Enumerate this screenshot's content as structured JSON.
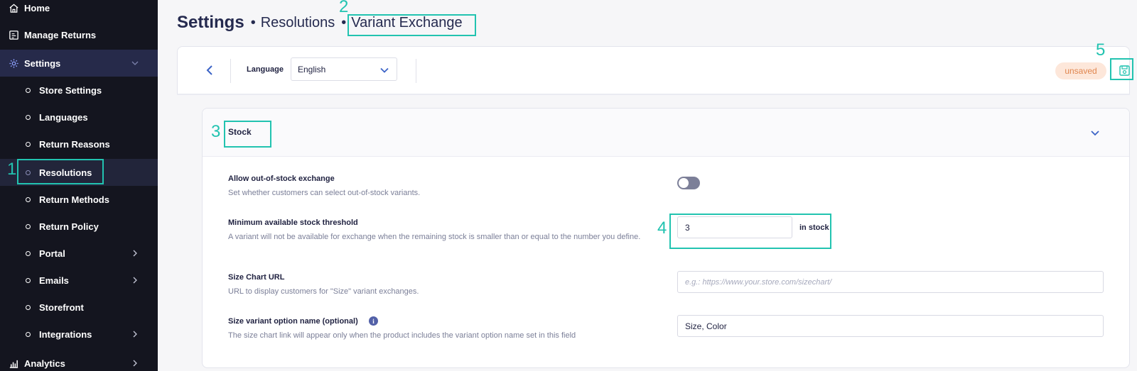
{
  "sidebar": {
    "items": [
      {
        "label": "Home"
      },
      {
        "label": "Manage Returns"
      },
      {
        "label": "Settings"
      },
      {
        "label": "Store Settings"
      },
      {
        "label": "Languages"
      },
      {
        "label": "Return Reasons"
      },
      {
        "label": "Resolutions"
      },
      {
        "label": "Return Methods"
      },
      {
        "label": "Return Policy"
      },
      {
        "label": "Portal"
      },
      {
        "label": "Emails"
      },
      {
        "label": "Storefront"
      },
      {
        "label": "Integrations"
      },
      {
        "label": "Analytics"
      }
    ]
  },
  "header": {
    "title": "Settings",
    "breadcrumb": [
      "Resolutions",
      "Variant Exchange"
    ]
  },
  "toolbar": {
    "language_label": "Language",
    "language_value": "English",
    "status_badge": "unsaved"
  },
  "stock": {
    "title": "Stock",
    "allow_oos": {
      "label": "Allow out-of-stock exchange",
      "description": "Set whether customers can select out-of-stock variants.",
      "enabled": false
    },
    "threshold": {
      "label": "Minimum available stock threshold",
      "description": "A variant will not be available for exchange when the remaining stock is smaller than or equal to the number you define.",
      "value": "3",
      "suffix": "in stock"
    },
    "size_chart_url": {
      "label": "Size Chart URL",
      "description": "URL to display customers for \"Size\" variant exchanges.",
      "placeholder": "e.g.: https://www.your.store.com/sizechart/"
    },
    "size_option_name": {
      "label": "Size variant option name (optional)",
      "description": "The size chart link will appear only when the product includes the variant option name set in this field",
      "value": "Size, Color"
    }
  },
  "annotations": {
    "n1": "1",
    "n2": "2",
    "n3": "3",
    "n4": "4",
    "n5": "5"
  },
  "colors": {
    "sidebar_bg": "#14151f",
    "active_bg": "#262a4a",
    "highlight": "#22c3b0",
    "badge_bg": "#fde7da",
    "badge_text": "#e0864f",
    "accent": "#3b63c6"
  }
}
